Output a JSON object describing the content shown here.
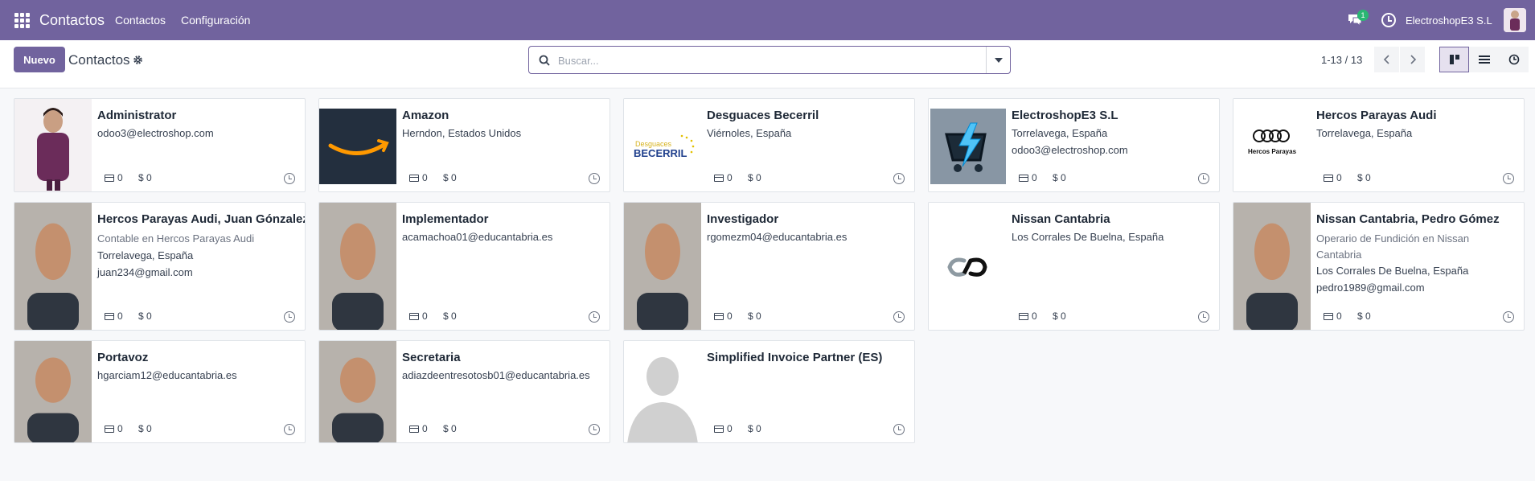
{
  "navbar": {
    "app_name": "Contactos",
    "menu": [
      "Contactos",
      "Configuración"
    ],
    "chat_badge": "1",
    "company": "ElectroshopE3 S.L"
  },
  "control": {
    "new_label": "Nuevo",
    "title": "Contactos",
    "search_placeholder": "Buscar...",
    "pager": "1-13 / 13"
  },
  "cards": [
    {
      "name": "Administrator",
      "lines": [
        "odoo3@electroshop.com"
      ],
      "bank": "0",
      "due": "$ 0",
      "image": "avatar-photo"
    },
    {
      "name": "Amazon",
      "lines": [
        "Herndon, Estados Unidos"
      ],
      "bank": "0",
      "due": "$ 0",
      "image": "amazon-logo"
    },
    {
      "name": "Desguaces Becerril",
      "lines": [
        "Viérnoles, España"
      ],
      "bank": "0",
      "due": "$ 0",
      "image": "becerril-logo",
      "logo_text": [
        "Desguaces",
        "BECERRIL"
      ]
    },
    {
      "name": "ElectroshopE3 S.L",
      "lines": [
        "Torrelavega, España",
        "odoo3@electroshop.com"
      ],
      "bank": "0",
      "due": "$ 0",
      "image": "electroshop-logo"
    },
    {
      "name": "Hercos Parayas Audi",
      "lines": [
        "Torrelavega, España"
      ],
      "bank": "0",
      "due": "$ 0",
      "image": "audi-logo",
      "logo_text": [
        "Hercos Parayas"
      ]
    },
    {
      "name": "Hercos Parayas Audi, Juan Gónzalez",
      "job": "Contable en Hercos Parayas Audi",
      "lines": [
        "Torrelavega, España",
        "juan234@gmail.com"
      ],
      "bank": "0",
      "due": "$ 0",
      "image": "person-photo"
    },
    {
      "name": "Implementador",
      "lines": [
        "acamachoa01@educantabria.es"
      ],
      "bank": "0",
      "due": "$ 0",
      "image": "person-photo"
    },
    {
      "name": "Investigador",
      "lines": [
        "rgomezm04@educantabria.es"
      ],
      "bank": "0",
      "due": "$ 0",
      "image": "person-photo"
    },
    {
      "name": "Nissan Cantabria",
      "lines": [
        "Los Corrales De Buelna, España"
      ],
      "bank": "0",
      "due": "$ 0",
      "image": "nissan-logo"
    },
    {
      "name": "Nissan Cantabria, Pedro Gómez",
      "job": "Operario de Fundición en Nissan Cantabria",
      "lines": [
        "Los Corrales De Buelna, España",
        "pedro1989@gmail.com"
      ],
      "bank": "0",
      "due": "$ 0",
      "image": "person-photo"
    },
    {
      "name": "Portavoz",
      "lines": [
        "hgarciam12@educantabria.es"
      ],
      "bank": "0",
      "due": "$ 0",
      "image": "person-photo"
    },
    {
      "name": "Secretaria",
      "lines": [
        "adiazdeentresotosb01@educantabria.es"
      ],
      "bank": "0",
      "due": "$ 0",
      "image": "person-photo"
    },
    {
      "name": "Simplified Invoice Partner (ES)",
      "lines": [],
      "bank": "0",
      "due": "$ 0",
      "image": "placeholder-avatar"
    }
  ],
  "colors": {
    "brand": "#71639e",
    "badge": "#2bb673"
  }
}
